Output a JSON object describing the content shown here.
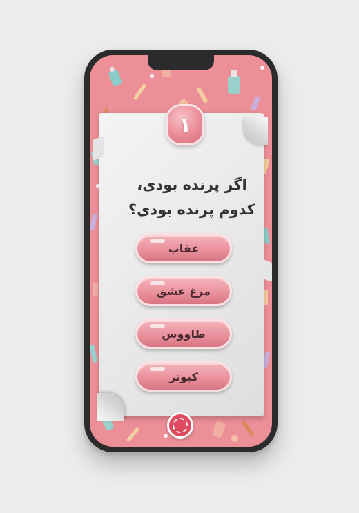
{
  "quiz": {
    "question_number": "۱",
    "question_line1": "اگر پرنده بودی،",
    "question_line2": "کدوم پرنده بودی؟",
    "answers": [
      {
        "label": "عقاب"
      },
      {
        "label": "مرغ عشق"
      },
      {
        "label": "طاووس"
      },
      {
        "label": "کبوتر"
      }
    ]
  },
  "colors": {
    "background": "#ec8f97",
    "paper": "#eeeeee",
    "button": "#e88f9a",
    "badge": "#ea8d98",
    "text": "#333333"
  },
  "icons": {
    "brand_logo": "brand-logo-icon",
    "background_pattern": "cosmetics-pattern"
  }
}
